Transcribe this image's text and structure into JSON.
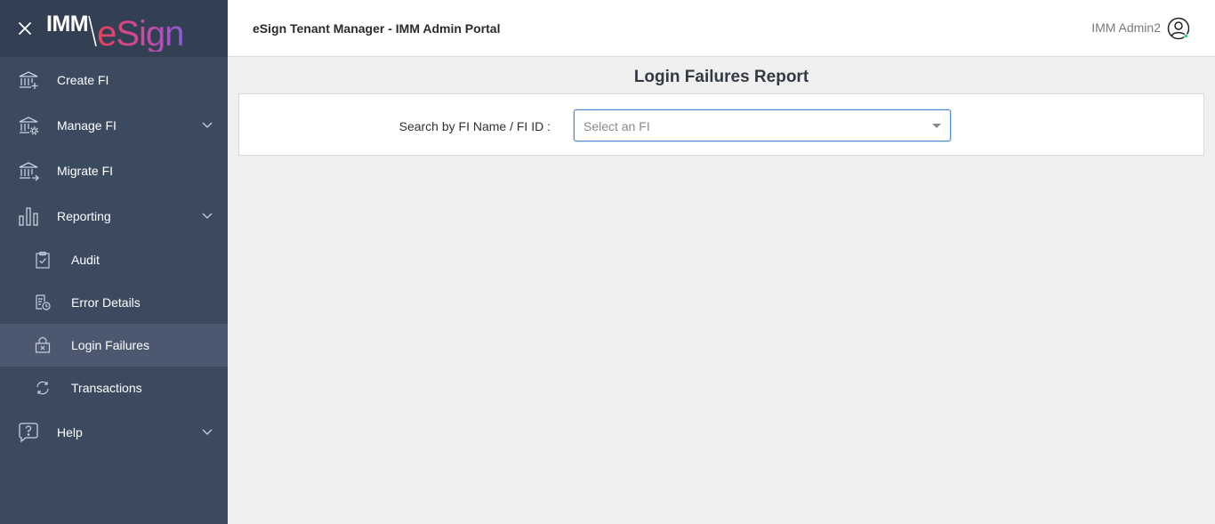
{
  "brand": {
    "logo_left": "IMM",
    "logo_right": "eSign"
  },
  "sidebar": {
    "items": [
      {
        "label": "Create FI",
        "icon": "bank-plus-icon"
      },
      {
        "label": "Manage FI",
        "icon": "bank-gear-icon"
      },
      {
        "label": "Migrate FI",
        "icon": "bank-arrow-icon"
      },
      {
        "label": "Reporting",
        "icon": "bar-chart-icon"
      }
    ],
    "reporting_sub": [
      {
        "label": "Audit",
        "icon": "clipboard-check-icon"
      },
      {
        "label": "Error Details",
        "icon": "document-clock-icon"
      },
      {
        "label": "Login Failures",
        "icon": "lock-x-icon",
        "active": true
      },
      {
        "label": "Transactions",
        "icon": "sync-icon"
      }
    ],
    "help": {
      "label": "Help",
      "icon": "help-bubble-icon"
    }
  },
  "header": {
    "title": "eSign Tenant Manager - IMM Admin Portal",
    "user_name": "IMM Admin2"
  },
  "main": {
    "page_title": "Login Failures Report",
    "search_label": "Search by FI Name / FI ID :",
    "select_placeholder": "Select an FI"
  },
  "colors": {
    "sidebar_bg": "#3c4a60",
    "brand_bg": "#333f53",
    "active_bg": "#4b5870",
    "focus_border": "#4a8bd0",
    "status_online": "#2ecc71"
  }
}
